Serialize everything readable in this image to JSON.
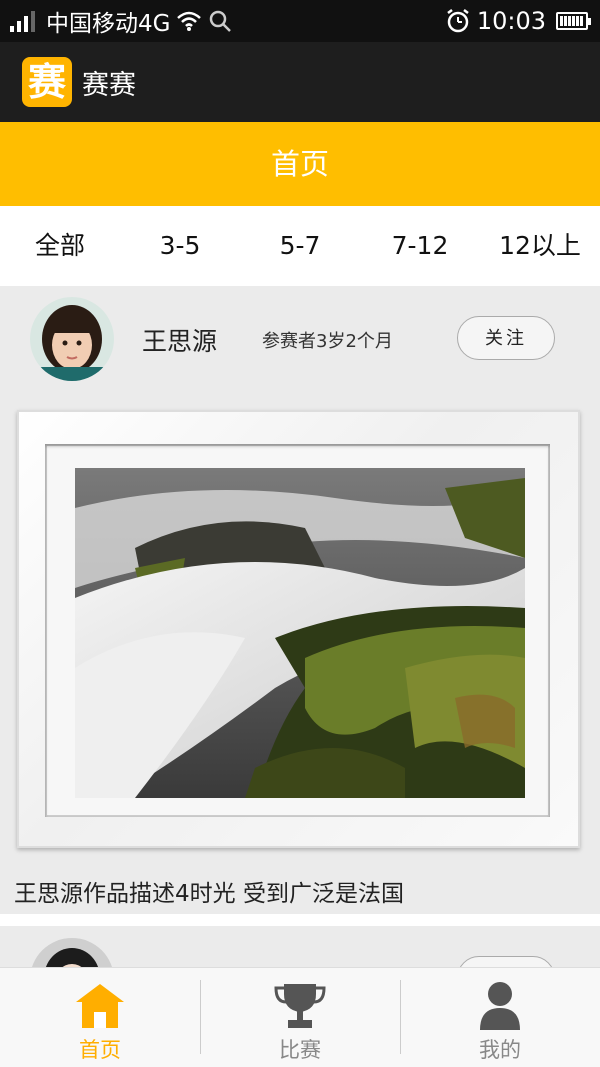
{
  "status_bar": {
    "carrier": "中国移动4G",
    "time": "10:03",
    "battery_level": 1.0
  },
  "app": {
    "logo_char": "赛",
    "title": "赛赛"
  },
  "page": {
    "title": "首页"
  },
  "filters": {
    "tabs": [
      "全部",
      "3-5",
      "5-7",
      "7-12",
      "12以上"
    ]
  },
  "post": {
    "author": "王思源",
    "meta": "参赛者3岁2个月",
    "follow_label": "关注",
    "description": "王思源作品描述4时光 受到广泛是法国",
    "artwork_icon": "waterfall-photo"
  },
  "bottom_nav": {
    "items": [
      {
        "label": "首页",
        "icon": "home-icon",
        "active": true
      },
      {
        "label": "比赛",
        "icon": "trophy-icon",
        "active": false
      },
      {
        "label": "我的",
        "icon": "user-icon",
        "active": false
      }
    ]
  },
  "colors": {
    "accent": "#ffbe00",
    "nav_active": "#ffae00",
    "nav_inactive": "#888888",
    "app_bar": "#1e1e1e"
  }
}
